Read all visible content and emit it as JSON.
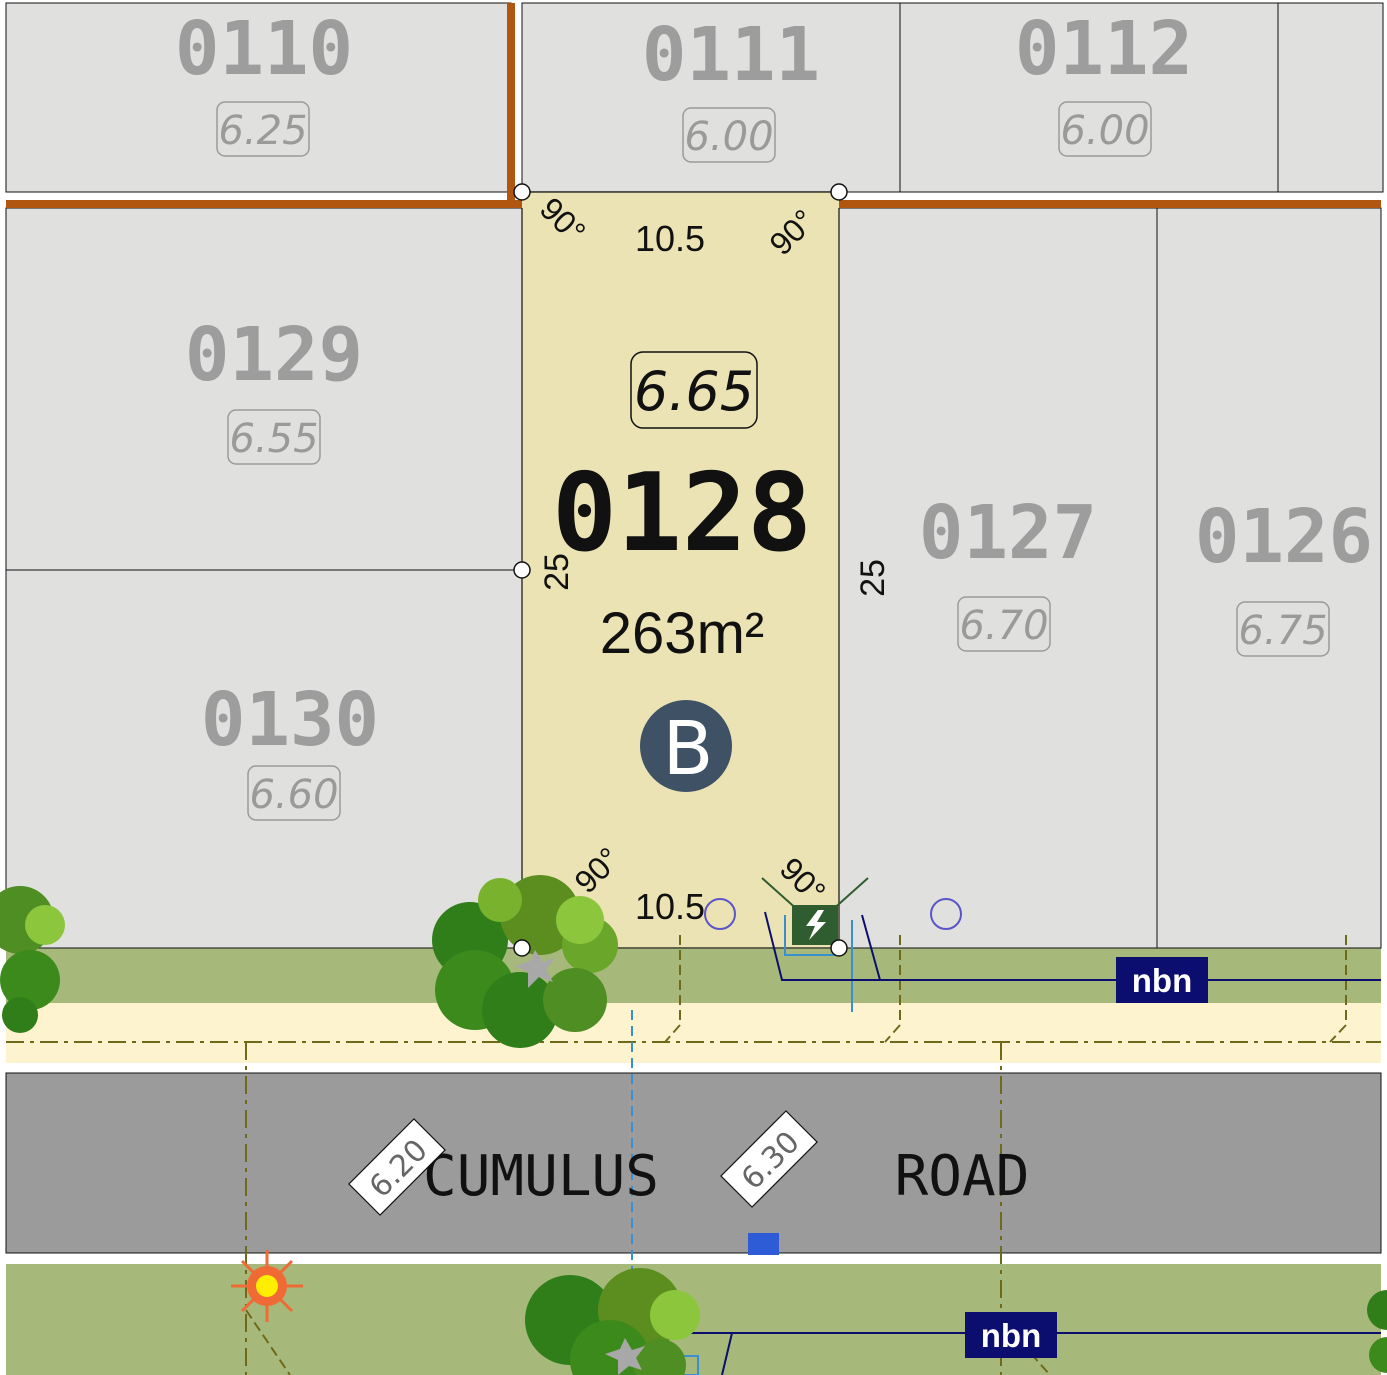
{
  "selected_lot": {
    "number": "0128",
    "level": "6.65",
    "area": "263m²",
    "badge": "B",
    "width_top": "10.5",
    "width_bottom": "10.5",
    "depth_left": "25",
    "depth_right": "25",
    "angle_label": "90°"
  },
  "lots": [
    {
      "number": "0110",
      "level": "6.25"
    },
    {
      "number": "0111",
      "level": "6.00"
    },
    {
      "number": "0112",
      "level": "6.00"
    },
    {
      "number": "0129",
      "level": "6.55"
    },
    {
      "number": "0130",
      "level": "6.60"
    },
    {
      "number": "0127",
      "level": "6.70"
    },
    {
      "number": "0126",
      "level": "6.75"
    }
  ],
  "road": {
    "name_part1": "CUMULUS",
    "name_part2": "ROAD",
    "level1": "6.20",
    "level2": "6.30"
  },
  "nbn_label": "nbn",
  "colors": {
    "lot_fill": "#e0e0de",
    "selected_fill": "#ebe3b4",
    "verge": "#a6b97a",
    "footpath": "#fdf3cf",
    "road": "#9b9b9b",
    "boundary_orange": "#b0560e",
    "badge": "#3e5165",
    "nbn": "#0b0e6e"
  }
}
